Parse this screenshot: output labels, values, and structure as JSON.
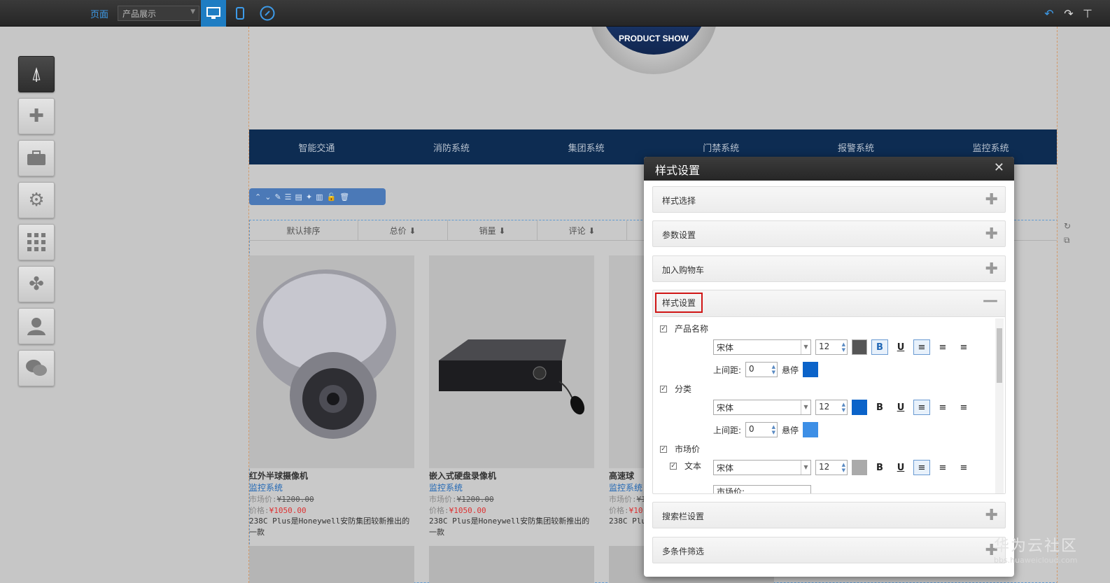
{
  "topbar": {
    "page_label": "页面",
    "page_select_value": "产品展示",
    "icons": [
      "desktop-icon",
      "mobile-icon",
      "link-icon",
      "undo-icon",
      "redo-icon",
      "pin-icon"
    ]
  },
  "leftbar": {
    "tools": [
      {
        "name": "app-store-icon",
        "glyph": "⍋",
        "active": true
      },
      {
        "name": "add-icon",
        "glyph": "✚",
        "active": false
      },
      {
        "name": "toolbox-icon",
        "glyph": "🧰",
        "active": false
      },
      {
        "name": "gear-icon",
        "glyph": "⚙",
        "active": false
      },
      {
        "name": "grid-icon",
        "glyph": "⠿",
        "active": false
      },
      {
        "name": "clover-icon",
        "glyph": "✤",
        "active": false
      },
      {
        "name": "user-icon",
        "glyph": "👤",
        "active": false
      },
      {
        "name": "wechat-icon",
        "glyph": "💬",
        "active": false
      }
    ]
  },
  "canvas": {
    "logo_text": "PRODUCT SHOW",
    "nav": [
      "智能交通",
      "消防系统",
      "集团系统",
      "门禁系统",
      "报警系统",
      "监控系统"
    ],
    "sort": [
      "默认排序",
      "总价 ⬇",
      "销量 ⬇",
      "评论 ⬇"
    ],
    "products": [
      {
        "name": "红外半球摄像机",
        "category": "监控系统",
        "market_label": "市场价:",
        "market": "¥1200.00",
        "price_label": "价格:",
        "price": "¥1050.00",
        "desc": "238C Plus是Honeywell安防集团较新推出的一款"
      },
      {
        "name": "嵌入式硬盘录像机",
        "category": "监控系统",
        "market_label": "市场价:",
        "market": "¥1200.00",
        "price_label": "价格:",
        "price": "¥1050.00",
        "desc": "238C Plus是Honeywell安防集团较新推出的一款"
      },
      {
        "name": "高速球",
        "category": "监控系统",
        "market_label": "市场价:",
        "market": "¥1",
        "price_label": "价格:",
        "price": "¥10",
        "desc": "238C Plus"
      }
    ]
  },
  "panel": {
    "title": "样式设置",
    "sections": [
      "样式选择",
      "参数设置",
      "加入购物车"
    ],
    "open_section": "样式设置",
    "sections_after": [
      "搜索栏设置",
      "多条件筛选"
    ],
    "style": {
      "product_name": {
        "label": "产品名称",
        "font": "宋体",
        "size": "12",
        "color": "#555555",
        "margin_label": "上间距:",
        "margin": "0",
        "hover_label": "悬停",
        "hover_color": "#0b63c9"
      },
      "category": {
        "label": "分类",
        "font": "宋体",
        "size": "12",
        "color": "#0b63c9",
        "margin_label": "上间距:",
        "margin": "0",
        "hover_label": "悬停",
        "hover_color": "#3d8fe6"
      },
      "market": {
        "label": "市场价",
        "text_label": "文本",
        "font": "宋体",
        "size": "12",
        "color": "#aaaaaa",
        "input_value": "市场价:"
      }
    }
  },
  "watermark": {
    "title": "华为云社区",
    "url": "bbs.huaweicloud.com"
  }
}
